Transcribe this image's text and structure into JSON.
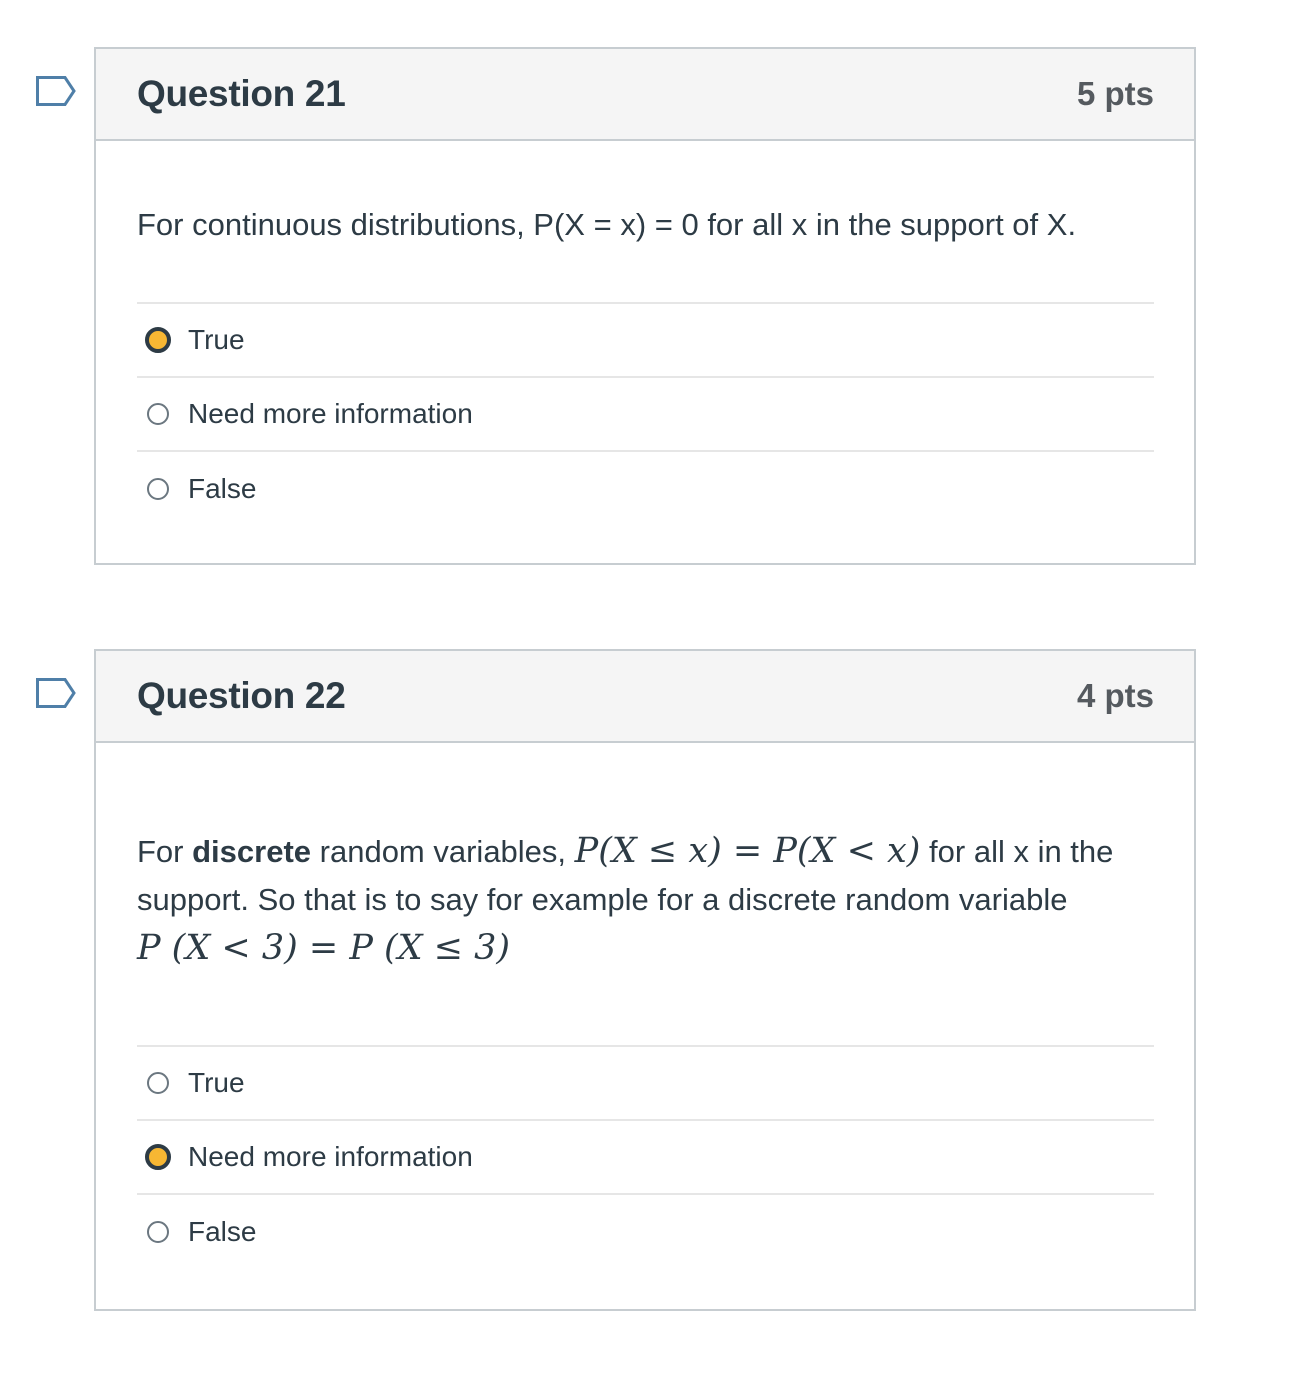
{
  "questions": [
    {
      "title": "Question 21",
      "points": "5 pts",
      "text": "For continuous distributions, P(X = x) = 0 for all x in the support of X.",
      "answers": [
        {
          "label": "True",
          "selected": true
        },
        {
          "label": "Need more information",
          "selected": false
        },
        {
          "label": "False",
          "selected": false
        }
      ]
    },
    {
      "title": "Question 22",
      "points": "4 pts",
      "text_parts": {
        "prefix": "For ",
        "bold": "discrete",
        "after_bold": " random variables, ",
        "math1": "P(X ≤ x) = P(X < x)",
        "after_math1": " for all x in the support. So that is to say for example for a discrete random variable ",
        "math2": "P (X < 3) = P (X ≤ 3)"
      },
      "answers": [
        {
          "label": "True",
          "selected": false
        },
        {
          "label": "Need more information",
          "selected": true
        },
        {
          "label": "False",
          "selected": false
        }
      ]
    }
  ],
  "colors": {
    "selected_radio_fill": "#f7b733",
    "flag_outline": "#4f7fa8"
  },
  "icons": {
    "flag": "flag-question-icon"
  }
}
